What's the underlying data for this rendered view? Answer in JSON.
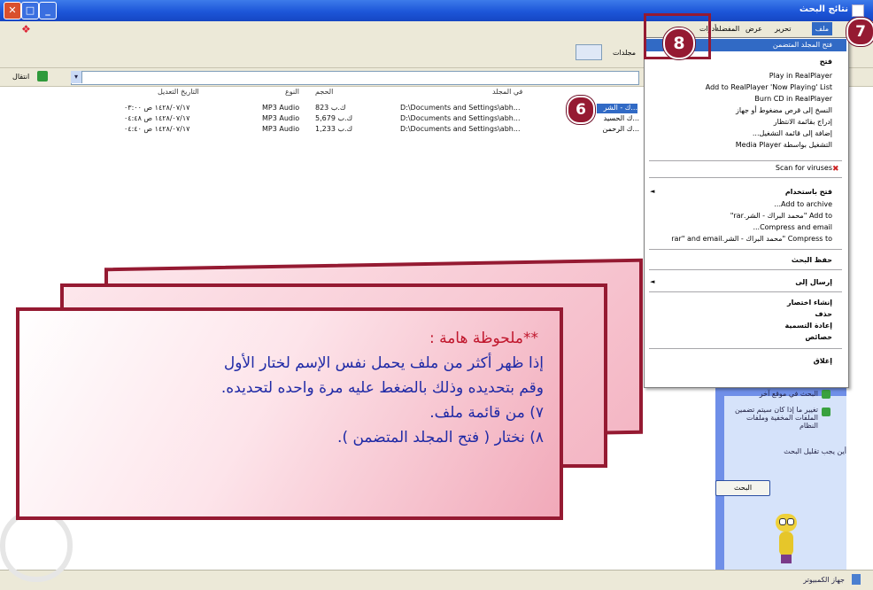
{
  "window": {
    "title": "نتائج البحث"
  },
  "menubar": {
    "items": [
      "ملف",
      "تحرير",
      "عرض",
      "المفضلة",
      "أدوات"
    ],
    "active": "ملف"
  },
  "toolbar": {
    "folders_label": "مجلدات"
  },
  "address": {
    "go_label": "انتقال"
  },
  "filelist": {
    "headers": [
      "في المجلد",
      "الحجم",
      "النوع",
      "التاريخ التعديل"
    ],
    "rows": [
      {
        "name": "...ك - الشر",
        "folder": "D:\\Documents and Settings\\abh...",
        "size": "823 ك.ب",
        "type": "MP3 Audio",
        "date": "١٤٢٨/٠٧/١٧ ص ٠٣:٠٠"
      },
      {
        "name": "...ك الحسيد",
        "folder": "D:\\Documents and Settings\\abh...",
        "size": "5,679 ك.ب",
        "type": "MP3 Audio",
        "date": "١٤٢٨/٠٧/١٧ ص ٠٤:٤٨"
      },
      {
        "name": "...ك الرحمن",
        "folder": "D:\\Documents and Settings\\abh...",
        "size": "1,233 ك.ب",
        "type": "MP3 Audio",
        "date": "١٤٢٨/٠٧/١٧ ص ٠٤:٤٠"
      }
    ]
  },
  "context_menu": {
    "highlighted": "فتح المجلد المتضمن",
    "items": [
      {
        "label": "فتح",
        "bold": true
      },
      {
        "label": "Play in RealPlayer"
      },
      {
        "label": "Add to RealPlayer 'Now Playing' List"
      },
      {
        "label": "Burn CD in RealPlayer"
      },
      {
        "label": "النسخ إلى قرص مضغوط أو جهاز"
      },
      {
        "label": "إدراج بقائمة الانتظار"
      },
      {
        "label": "إضافة إلى قائمة التشغيل..."
      },
      {
        "label": "التشغيل بواسطة Media Player"
      },
      {
        "label": "Scan for viruses"
      },
      {
        "label": "فتح باستخدام"
      },
      {
        "label": "Add to archive..."
      },
      {
        "label": "Add to \"محمد البراك - الشر.rar\""
      },
      {
        "label": "Compress and email..."
      },
      {
        "label": "Compress to \"محمد البراك - الشر.rar\" and email"
      },
      {
        "label": "حفظ البحث"
      },
      {
        "label": "إرسال إلى"
      },
      {
        "label": "إنشاء اختصار"
      },
      {
        "label": "حذف"
      },
      {
        "label": "إعادة التسمية"
      },
      {
        "label": "خصائص"
      },
      {
        "label": "إغلاق"
      }
    ]
  },
  "side_panel": {
    "tasks": [
      "البحث في موقع آخر",
      "تغيير ما إذا كان سيتم تضمين الملفات المخفية وملفات النظام"
    ],
    "hint": "أين يجب تقليل البحث",
    "search_button": "البحث"
  },
  "statusbar": {
    "text": "جهاز الكمبيوتر"
  },
  "badges": [
    "6",
    "7",
    "8"
  ],
  "note": {
    "title": "**ملحوظة هامة :",
    "lines": [
      "إذا ظهر أكثر من ملف يحمل نفس الإسم لختار الأول",
      "وقم بتحديده وذلك بالضغط عليه مرة واحده لتحديده.",
      "٧) من قائمة ملف.",
      "٨) نختار ( فتح المجلد المتضمن )."
    ]
  },
  "colors": {
    "accent": "#951a32",
    "note_text": "#1f2aa6",
    "note_title": "#c0162c",
    "highlight": "#316ac5"
  }
}
